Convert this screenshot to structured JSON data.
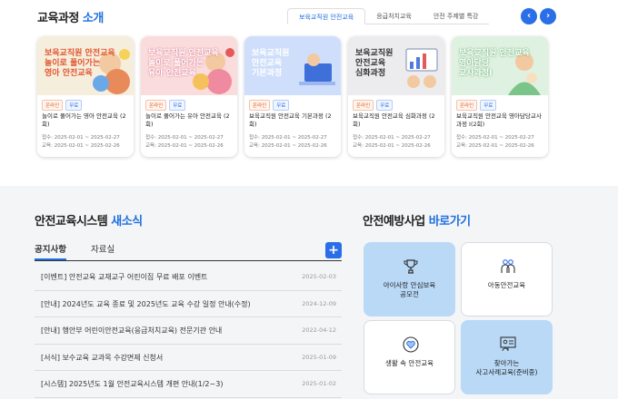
{
  "header": {
    "title_main": "교육과정",
    "title_accent": "소개",
    "tabs": [
      "보육교직원 안전교육",
      "응급처치교육",
      "안전 주제별 특강"
    ],
    "prev_label": "‹",
    "next_label": "›"
  },
  "courses": [
    {
      "thumb_text": "보육교직원 안전교육\n놀이로 풀어가는\n영아 안전교육",
      "online": "온라인",
      "free": "무료",
      "title": "놀이로 풀어가는 영아 안전교육 (2회)",
      "apply": "접수: 2025-02-01 ~ 2025-02-27",
      "edu": "교육: 2025-02-01 ~ 2025-02-26",
      "bg": "#f6eedd"
    },
    {
      "thumb_text": "보육교직원 안전교육\n놀이로 풀어가는\n유아 안전교육",
      "online": "온라인",
      "free": "무료",
      "title": "놀이로 풀어가는 유아 안전교육 (2회)",
      "apply": "접수: 2025-02-01 ~ 2025-02-27",
      "edu": "교육: 2025-02-01 ~ 2025-02-26",
      "bg": "#fbdcdc"
    },
    {
      "thumb_text": "보육교직원\n안전교육\n기본과정",
      "online": "온라인",
      "free": "무료",
      "title": "보육교직원 안전교육 기본과정 (2회)",
      "apply": "접수: 2025-02-01 ~ 2025-02-27",
      "edu": "교육: 2025-02-01 ~ 2025-02-26",
      "bg": "#cfdffb"
    },
    {
      "thumb_text": "보육교직원\n안전교육\n심화과정",
      "online": "온라인",
      "free": "무료",
      "title": "보육교직원 안전교육 심화과정 (2회)",
      "apply": "접수: 2025-02-01 ~ 2025-02-27",
      "edu": "교육: 2025-02-01 ~ 2025-02-26",
      "bg": "#ececef"
    },
    {
      "thumb_text": "보육교직원 안전교육\n영아담당\n교사과정Ⅰ",
      "online": "온라인",
      "free": "무료",
      "title": "보육교직원 안전교육 영아담당교사과정 Ⅰ(2회)",
      "apply": "접수: 2025-02-01 ~ 2025-02-27",
      "edu": "교육: 2025-02-01 ~ 2025-02-26",
      "bg": "#dff1e0"
    }
  ],
  "news": {
    "title_main": "안전교육시스템",
    "title_accent": "새소식",
    "tabs": [
      "공지사항",
      "자료실"
    ],
    "plus_label": "+",
    "items": [
      {
        "text": "[이벤트] 안전교육 교재교구 어린이집 무료 배포 이벤트",
        "date": "2025-02-03"
      },
      {
        "text": "[안내] 2024년도 교육 종료 및 2025년도 교육 수강 일정 안내(수정)",
        "date": "2024-12-09"
      },
      {
        "text": "[안내] 행안부 어린이안전교육(응급처치교육) 전문기관 안내",
        "date": "2022-04-12"
      },
      {
        "text": "[서식] 보수교육 교과목 수강면제 신청서",
        "date": "2025-01-09"
      },
      {
        "text": "[시스템] 2025년도 1월 안전교육시스템 개편 안내(1/2~3)",
        "date": "2025-01-02"
      }
    ]
  },
  "prevention": {
    "title_main": "안전예방사업",
    "title_accent": "바로가기",
    "tiles": [
      {
        "label": "아이사랑 안심보육\n공모전",
        "icon": "trophy-icon"
      },
      {
        "label": "아동안전교육",
        "icon": "children-icon"
      },
      {
        "label": "생활 속 안전교육",
        "icon": "safety-heart-icon"
      },
      {
        "label": "찾아가는\n사고사례교육(준비중)",
        "icon": "presentation-icon"
      }
    ]
  }
}
